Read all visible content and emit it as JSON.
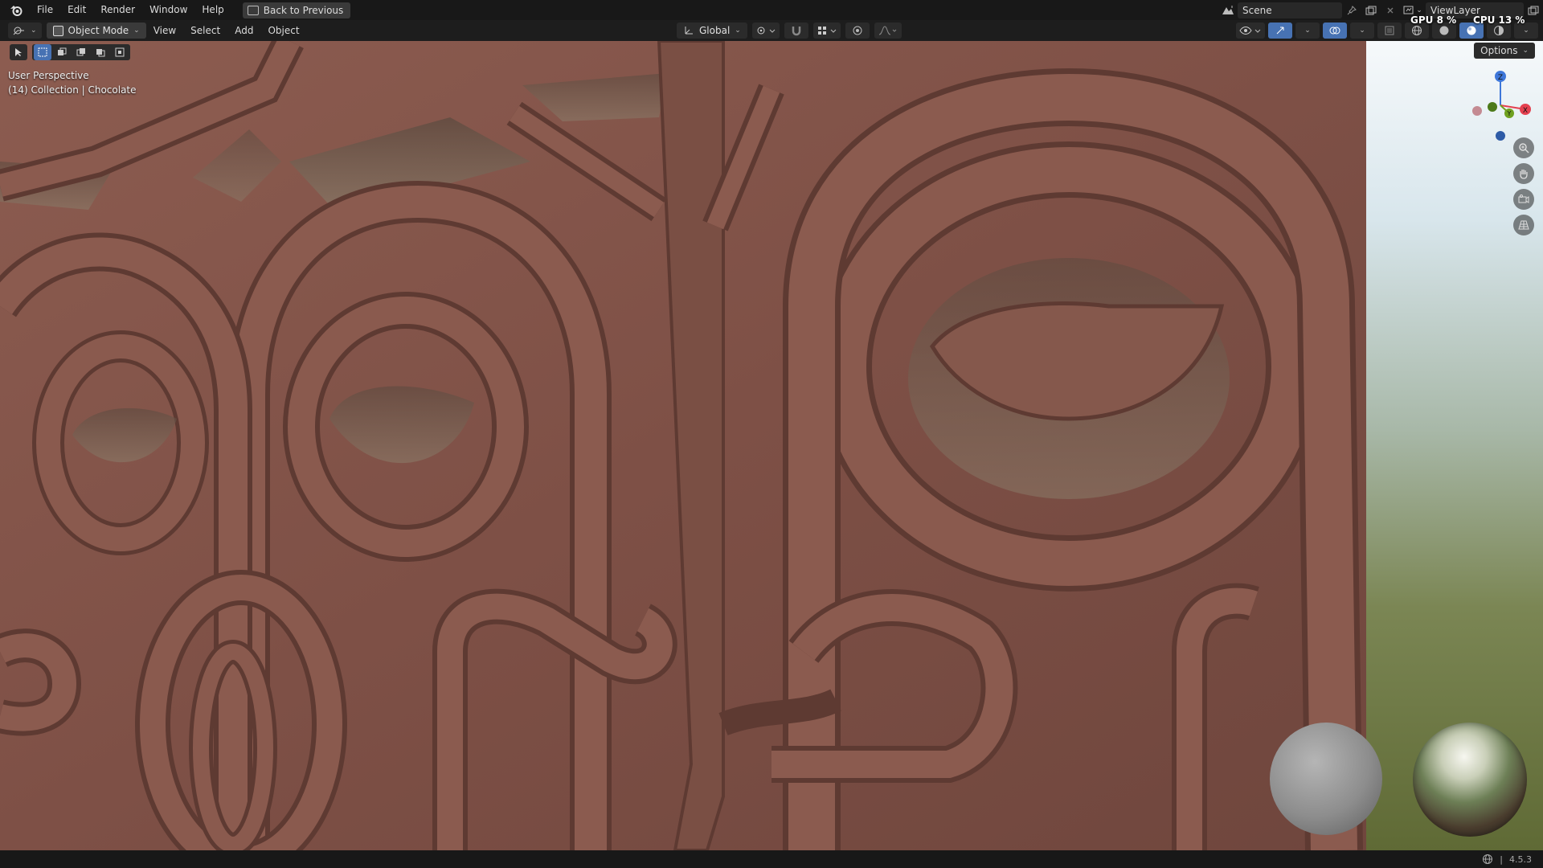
{
  "menubar": {
    "items": [
      "File",
      "Edit",
      "Render",
      "Window",
      "Help"
    ],
    "back_button": "Back to Previous",
    "scene": "Scene",
    "view_layer": "ViewLayer"
  },
  "stats": {
    "gpu": "GPU 8 %",
    "cpu": "CPU 13 %"
  },
  "viewport_header": {
    "mode": "Object Mode",
    "menus": [
      "View",
      "Select",
      "Add",
      "Object"
    ],
    "transform_orientation": "Global"
  },
  "viewport": {
    "perspective_label": "User Perspective",
    "collection_label": "(14) Collection | Chocolate",
    "options_label": "Options",
    "gizmo": {
      "x": "X",
      "y": "Y",
      "z": "Z"
    }
  },
  "statusbar": {
    "version": "4.5.3"
  },
  "colors": {
    "chocolate": "#7f5247",
    "accent_blue": "#4772b3",
    "axis_x": "#e4404f",
    "axis_y": "#6fa01f",
    "axis_z": "#3e77d9"
  }
}
